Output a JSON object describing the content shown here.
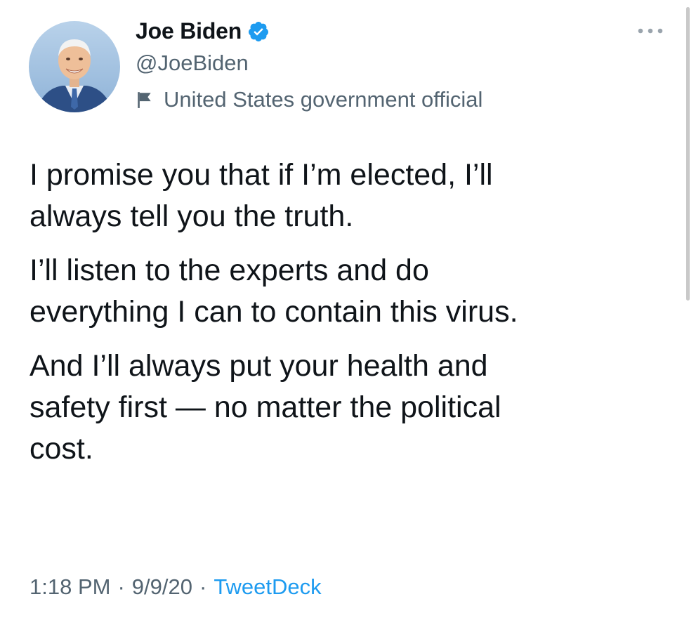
{
  "tweet": {
    "author": {
      "display_name": "Joe Biden",
      "handle": "@JoeBiden",
      "verified": true,
      "label": "United States government official"
    },
    "paragraphs": [
      {
        "lines": [
          "I promise you that if I’m elected, I’ll",
          "always tell you the truth."
        ]
      },
      {
        "lines": [
          "I’ll listen to the experts and do",
          "everything I can to contain this virus."
        ]
      },
      {
        "lines": [
          "And I’ll always put your health and",
          "safety first — no matter the political",
          "cost."
        ]
      }
    ],
    "meta": {
      "time": "1:18 PM",
      "date": "9/9/20",
      "separator": "·",
      "source": "TweetDeck"
    }
  },
  "colors": {
    "text": "#0f1419",
    "secondary": "#536471",
    "link": "#1d9bf0",
    "verified": "#1d9bf0"
  },
  "icons": {
    "verified": "verified-badge-icon",
    "label": "flag-icon",
    "more": "more-options-icon"
  }
}
